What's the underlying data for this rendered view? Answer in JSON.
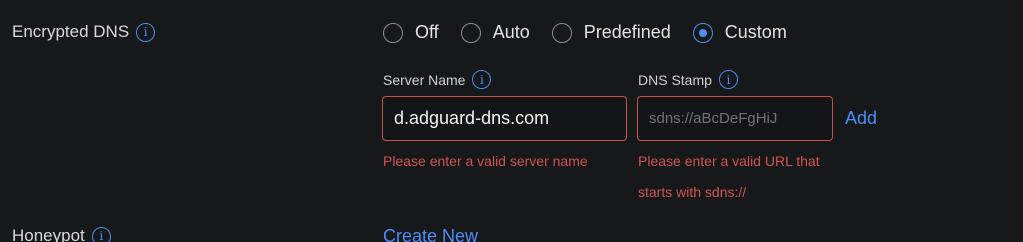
{
  "encrypted_dns": {
    "label": "Encrypted DNS",
    "options": [
      {
        "label": "Off",
        "checked": false
      },
      {
        "label": "Auto",
        "checked": false
      },
      {
        "label": "Predefined",
        "checked": false
      },
      {
        "label": "Custom",
        "checked": true
      }
    ]
  },
  "server_name": {
    "label": "Server Name",
    "value": "d.adguard-dns.com",
    "error": "Please enter a valid server name"
  },
  "dns_stamp": {
    "label": "DNS Stamp",
    "placeholder": "sdns://aBcDeFgHiJ",
    "error": "Please enter a valid URL that starts with sdns://"
  },
  "add_label": "Add",
  "honeypot": {
    "label": "Honeypot",
    "create_label": "Create New"
  },
  "colors": {
    "background": "#17181a",
    "accent": "#4d8df6",
    "error": "#d1544f"
  }
}
